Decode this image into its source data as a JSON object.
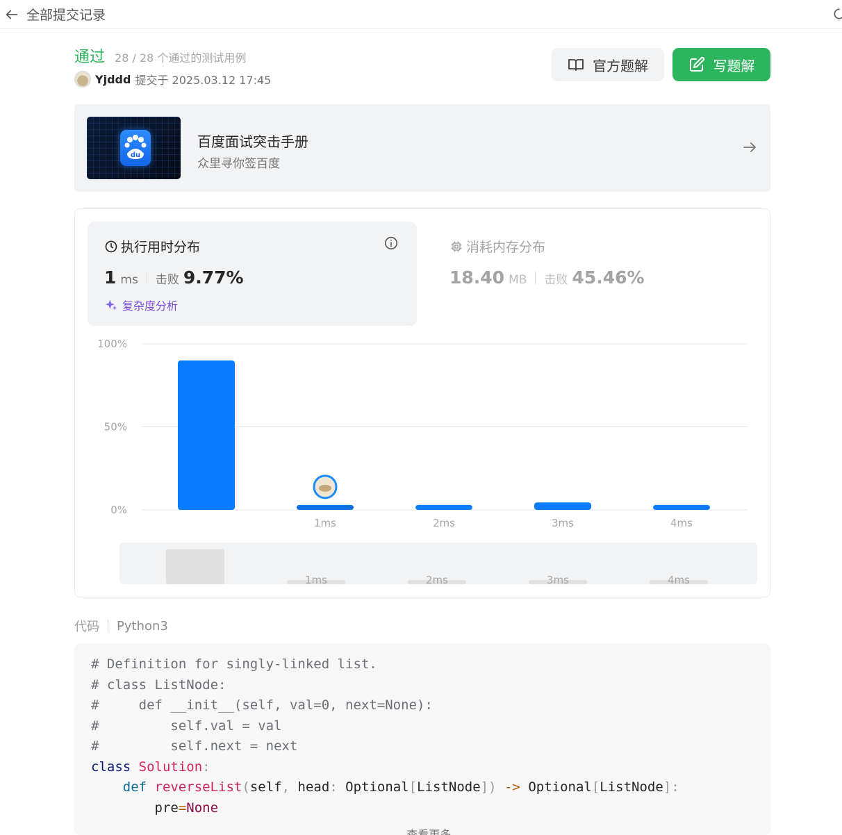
{
  "topbar": {
    "back_label": "全部提交记录"
  },
  "submission": {
    "status": "通过",
    "cases": "28 / 28 个通过的测试用例",
    "username": "Yjddd",
    "submitted_at": "提交于 2025.03.12 17:45"
  },
  "buttons": {
    "official": "官方题解",
    "write": "写题解"
  },
  "banner": {
    "title": "百度面试突击手册",
    "subtitle": "众里寻你签百度",
    "logo_text": "du"
  },
  "runtime": {
    "title": "执行用时分布",
    "value": "1",
    "unit": "ms",
    "beat_label": "击败",
    "beat_pct": "9.77%",
    "complexity": "复杂度分析"
  },
  "memory": {
    "title": "消耗内存分布",
    "value": "18.40",
    "unit": "MB",
    "beat_label": "击败",
    "beat_pct": "45.46%"
  },
  "chart_data": {
    "type": "bar",
    "y_ticks": [
      "100%",
      "50%",
      "0%"
    ],
    "ylim": [
      0,
      100
    ],
    "categories": [
      "",
      "1ms",
      "2ms",
      "3ms",
      "4ms"
    ],
    "values": [
      90,
      3,
      3,
      4.5,
      3
    ],
    "highlight_index": 1,
    "overview_labels": [
      "",
      "1ms",
      "2ms",
      "3ms",
      "4ms"
    ]
  },
  "code": {
    "label": "代码",
    "language": "Python3",
    "show_more": "查看更多"
  }
}
